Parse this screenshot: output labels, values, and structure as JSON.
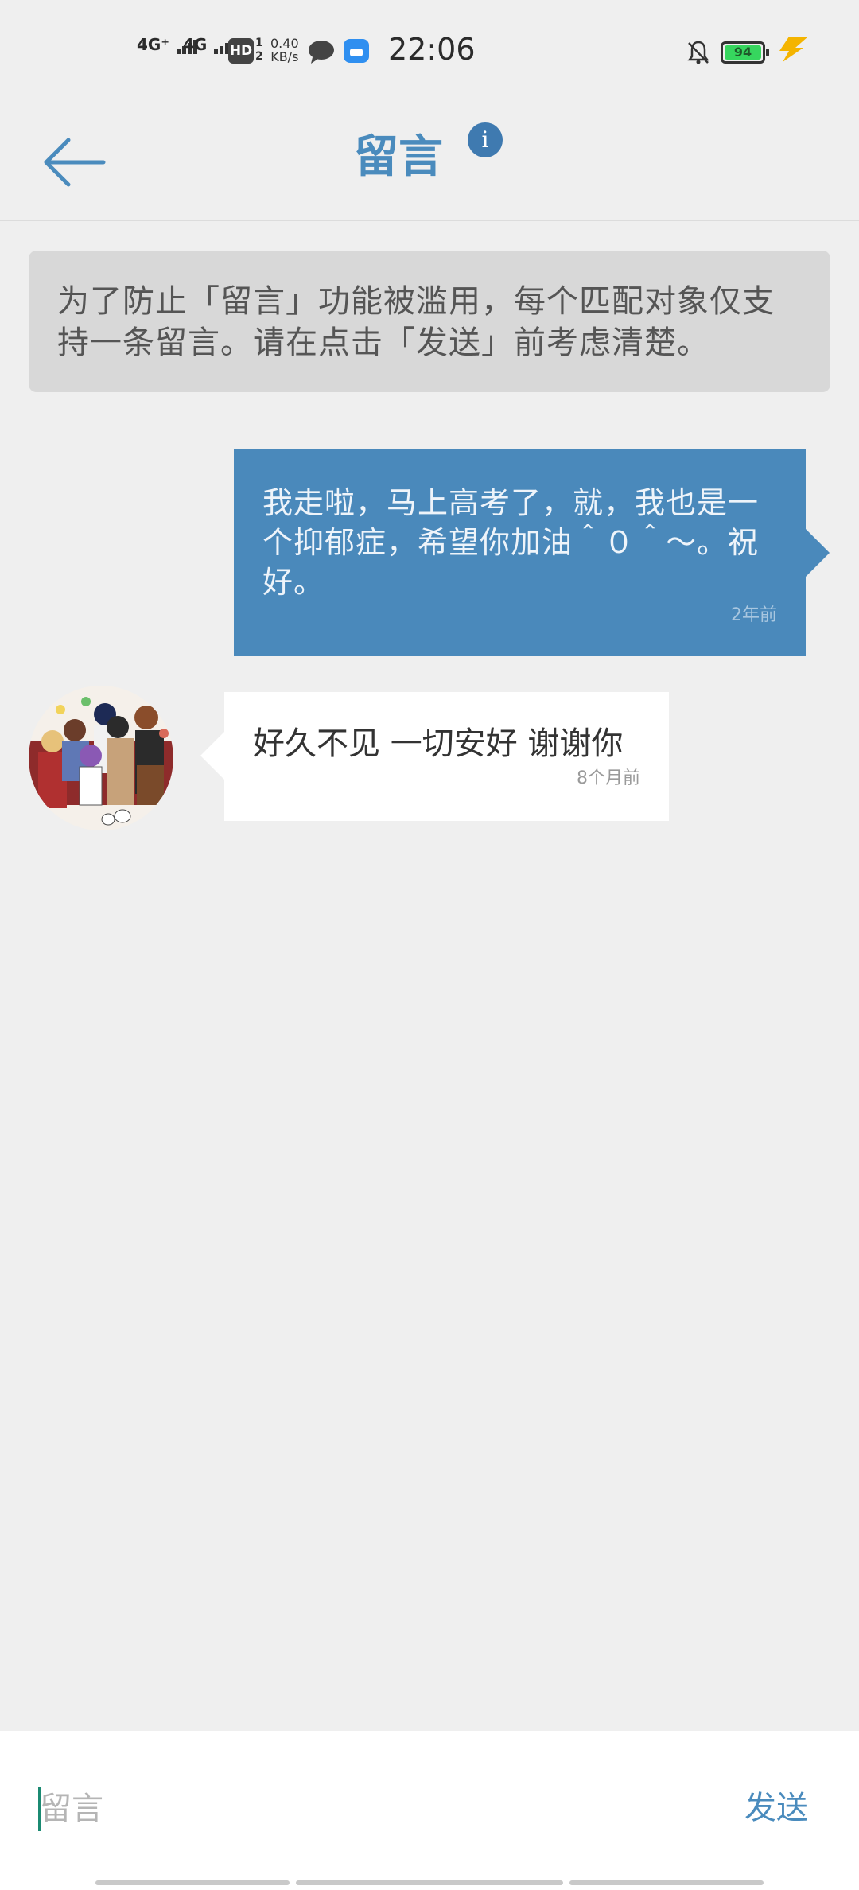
{
  "status_bar": {
    "signal1": "4G⁺",
    "signal2": "4G",
    "hd_label": "HD",
    "hd_sub_top": "1",
    "hd_sub_bottom": "2",
    "speed_value": "0.40",
    "speed_unit": "KB/s",
    "time": "22:06",
    "battery": "94",
    "battery_color": "#36d65e",
    "charging_color": "#f4b400"
  },
  "header": {
    "title": "留言",
    "info_label": "i",
    "accent_color": "#4a8bbd"
  },
  "notice": {
    "text": "为了防止「留言」功能被滥用，每个匹配对象仅支持一条留言。请在点击「发送」前考虑清楚。"
  },
  "messages": [
    {
      "direction": "sent",
      "text": "我走啦，马上高考了，就，我也是一个抑郁症，希望你加油＾０＾～。祝好。",
      "time": "2年前",
      "bubble_color": "#4a89bb"
    },
    {
      "direction": "received",
      "text": "好久不见 一切安好 谢谢你",
      "time": "8个月前"
    }
  ],
  "input": {
    "placeholder": "留言",
    "value": "",
    "send_label": "发送"
  }
}
